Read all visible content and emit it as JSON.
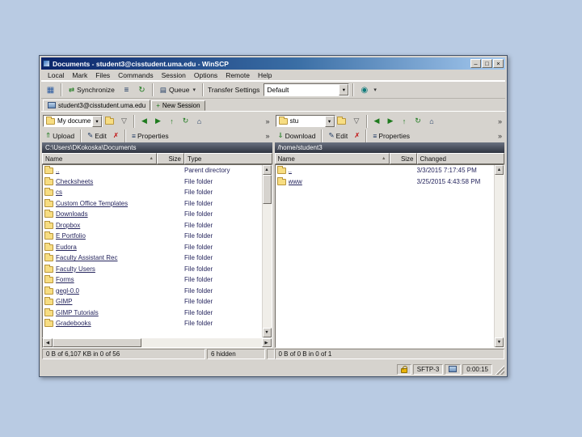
{
  "window": {
    "title": "Documents - student3@cisstudent.uma.edu - WinSCP",
    "menu": [
      "Local",
      "Mark",
      "Files",
      "Commands",
      "Session",
      "Options",
      "Remote",
      "Help"
    ],
    "toolbar": {
      "synchronize_label": "Synchronize",
      "queue_label": "Queue",
      "transfer_settings_label": "Transfer Settings",
      "transfer_settings_value": "Default"
    },
    "tabs": [
      {
        "label": "student3@cisstudent.uma.edu"
      },
      {
        "label": "New Session"
      }
    ],
    "left_panel": {
      "drive_combo": "My docume",
      "actions": {
        "upload": "Upload",
        "edit": "Edit",
        "properties": "Properties"
      },
      "path": "C:\\Users\\DKokoska\\Documents",
      "columns": [
        "Name",
        "Size",
        "Type"
      ],
      "rows": [
        {
          "name": "..",
          "size": "",
          "type": "Parent directory"
        },
        {
          "name": "Checksheets",
          "size": "",
          "type": "File folder"
        },
        {
          "name": "cs",
          "size": "",
          "type": "File folder"
        },
        {
          "name": "Custom Office Templates",
          "size": "",
          "type": "File folder"
        },
        {
          "name": "Downloads",
          "size": "",
          "type": "File folder"
        },
        {
          "name": "Dropbox",
          "size": "",
          "type": "File folder"
        },
        {
          "name": "E Portfolio",
          "size": "",
          "type": "File folder"
        },
        {
          "name": "Eudora",
          "size": "",
          "type": "File folder"
        },
        {
          "name": "Faculty Assistant Rec",
          "size": "",
          "type": "File folder"
        },
        {
          "name": "Faculty Users",
          "size": "",
          "type": "File folder"
        },
        {
          "name": "Forms",
          "size": "",
          "type": "File folder"
        },
        {
          "name": "gegl-0.0",
          "size": "",
          "type": "File folder"
        },
        {
          "name": "GIMP",
          "size": "",
          "type": "File folder"
        },
        {
          "name": "GIMP Tutorials",
          "size": "",
          "type": "File folder"
        },
        {
          "name": "Gradebooks",
          "size": "",
          "type": "File folder"
        }
      ],
      "status_size": "0 B of 6,107 KB in 0 of 56",
      "status_hidden": "6 hidden"
    },
    "right_panel": {
      "drive_combo": "stu",
      "actions": {
        "download": "Download",
        "edit": "Edit",
        "properties": "Properties"
      },
      "path": "/home/student3",
      "columns": [
        "Name",
        "Size",
        "Changed"
      ],
      "rows": [
        {
          "name": "..",
          "size": "",
          "changed": "3/3/2015 7:17:45 PM"
        },
        {
          "name": "www",
          "size": "",
          "changed": "3/25/2015 4:43:58 PM"
        }
      ],
      "status": "0 B of 0 B in 0 of 1"
    },
    "statusbar": {
      "protocol": "SFTP-3",
      "duration": "0:00:15"
    }
  },
  "icons": {
    "grid": "▦",
    "sync": "⇄",
    "console": "≡",
    "refresh": "↻",
    "queue": "▤",
    "dropdown": "▾",
    "preset": "◉",
    "filter": "▽",
    "back": "◀",
    "forward": "▶",
    "up": "↑",
    "home": "⌂",
    "overflow": "»",
    "upload": "⇑",
    "download": "⇓",
    "edit": "✎",
    "delete": "✗",
    "props": "≡",
    "sort_asc": "▲",
    "scroll_up": "▲",
    "scroll_down": "▼",
    "scroll_left": "◀",
    "scroll_right": "▶",
    "minimize": "–",
    "maximize": "□",
    "close": "×",
    "new_session": "+"
  }
}
